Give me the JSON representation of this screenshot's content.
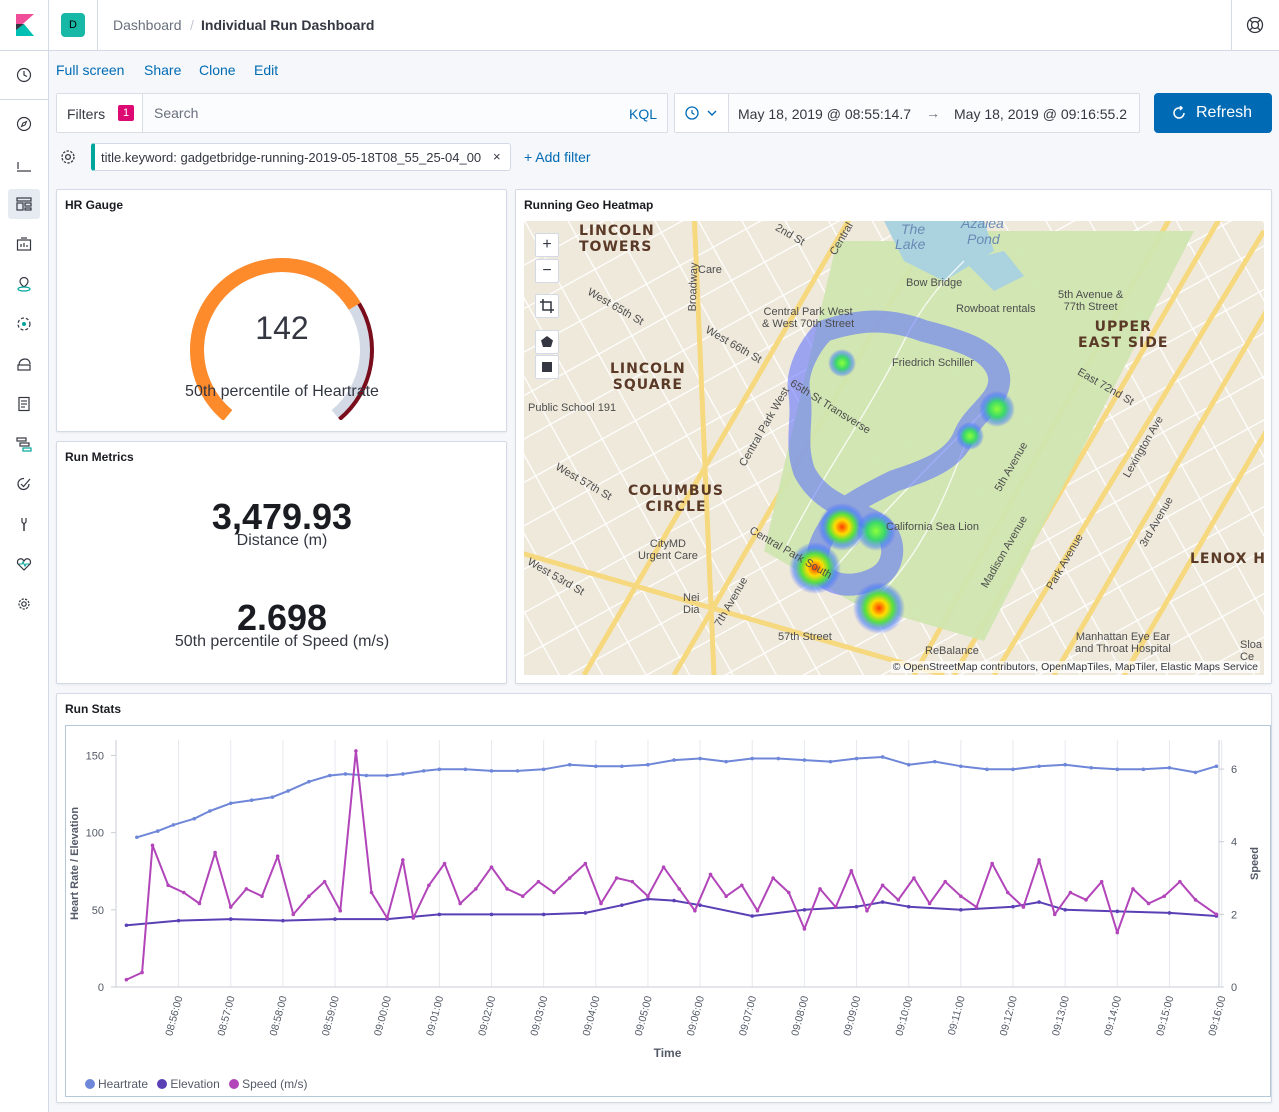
{
  "breadcrumbs": [
    "Dashboard",
    "Individual Run Dashboard"
  ],
  "space_initial": "D",
  "menu": [
    "Full screen",
    "Share",
    "Clone",
    "Edit"
  ],
  "filters": {
    "label": "Filters",
    "count": "1",
    "search_placeholder": "Search",
    "query_language": "KQL"
  },
  "time": {
    "start": "May 18, 2019 @ 08:55:14.7",
    "arrow": "→",
    "end": "May 18, 2019 @ 09:16:55.2"
  },
  "refresh_label": "Refresh",
  "filter_pill": "title.keyword: gadgetbridge-running-2019-05-18T08_55_25-04_00",
  "filter_pill_close": "×",
  "add_filter": "+ Add filter",
  "colors": {
    "accent": "#006bb4",
    "badge": "#dd0a73",
    "filter_pill": "#00a69b",
    "gauge_orange": "#fd8b2c",
    "gauge_dark": "#7a0d1c"
  },
  "panels": {
    "hr_gauge": {
      "title": "HR Gauge",
      "value": "142",
      "label": "50th percentile of Heartrate",
      "value_fraction": 0.71
    },
    "run_metrics": {
      "title": "Run Metrics",
      "metrics": [
        {
          "value": "3,479.93",
          "label": "Distance (m)"
        },
        {
          "value": "2.698",
          "label": "50th percentile of Speed (m/s)"
        }
      ]
    },
    "geo_heatmap": {
      "title": "Running Geo Heatmap",
      "zoom_in": "+",
      "zoom_out": "−",
      "attribution": "© OpenStreetMap contributors, OpenMapTiles, MapTiler, Elastic Maps Service",
      "places_major": [
        "LINCOLN\nTOWERS",
        "LINCOLN\nSQUARE",
        "COLUMBUS\nCIRCLE",
        "UPPER\nEAST SIDE",
        "LENOX HI"
      ],
      "places_minor": [
        "The",
        "Lake",
        "Azalea",
        "Pond",
        "Bow Bridge",
        "Rowboat rentals",
        "5th Avenue &\n77th Street",
        "Central Park West\n& West 70th Street",
        "Friedrich Schiller",
        "Public School 191",
        "California Sea Lion",
        "CityMD\nUrgent Care",
        "57th Street",
        "ReBalance",
        "Manhattan Eye Ear\nand Throat Hospital",
        "Nei\nDia",
        "Sloa\nCe",
        "Care"
      ],
      "streets": [
        "West 65th St",
        "West 66th St",
        "West 57th St",
        "65th St Transverse",
        "Central Park West",
        "Central Park South",
        "East 72nd St",
        "5th Avenue",
        "Madison Avenue",
        "Park Avenue",
        "Lexington Ave",
        "3rd Avenue",
        "Broadway",
        "7th Avenue",
        "Central",
        "2nd St",
        "West 53rd St"
      ]
    },
    "run_stats": {
      "title": "Run Stats",
      "legend": [
        "Heartrate",
        "Elevation",
        "Speed (m/s)"
      ]
    }
  },
  "chart_data": {
    "type": "line",
    "title": "",
    "xlabel": "Time",
    "ylabel": "Heart Rate / Elevation",
    "y2label": "Speed",
    "ylim": [
      0,
      160
    ],
    "y2lim": [
      0,
      6.8
    ],
    "yticks": [
      0,
      50,
      100,
      150
    ],
    "y2ticks": [
      0,
      2,
      4,
      6
    ],
    "x_ticks": [
      "08:56:00",
      "08:57:00",
      "08:58:00",
      "08:59:00",
      "09:00:00",
      "09:01:00",
      "09:02:00",
      "09:03:00",
      "09:04:00",
      "09:05:00",
      "09:06:00",
      "09:07:00",
      "09:08:00",
      "09:09:00",
      "09:10:00",
      "09:11:00",
      "09:12:00",
      "09:13:00",
      "09:14:00",
      "09:15:00",
      "09:16:00"
    ],
    "x_range_minutes": [
      -0.2,
      20.95
    ],
    "grid": true,
    "legend_position": "bottom-left",
    "series": [
      {
        "name": "Heartrate",
        "axis": "left",
        "color": "#6f87d8",
        "x": [
          0.2,
          0.6,
          0.9,
          1.3,
          1.6,
          2.0,
          2.4,
          2.8,
          3.1,
          3.5,
          3.9,
          4.2,
          4.6,
          5.0,
          5.3,
          5.7,
          6.0,
          6.5,
          7.0,
          7.5,
          8.0,
          8.5,
          9.0,
          9.5,
          10.0,
          10.5,
          11.0,
          11.5,
          12.0,
          12.5,
          13.0,
          13.5,
          14.0,
          14.5,
          15.0,
          15.5,
          16.0,
          16.5,
          17.0,
          17.5,
          18.0,
          18.5,
          19.0,
          19.5,
          20.0,
          20.5,
          20.9
        ],
        "values": [
          97,
          101,
          105,
          109,
          114,
          119,
          121,
          123,
          127,
          133,
          137,
          138,
          137,
          137,
          138,
          140,
          141,
          141,
          140,
          140,
          141,
          144,
          143,
          143,
          144,
          147,
          148,
          146,
          148,
          148,
          147,
          146,
          148,
          149,
          144,
          146,
          143,
          141,
          141,
          143,
          144,
          142,
          141,
          141,
          142,
          139,
          143
        ]
      },
      {
        "name": "Elevation",
        "axis": "left",
        "color": "#5a3fb5",
        "x": [
          0.0,
          1.0,
          2.0,
          3.0,
          4.0,
          5.0,
          6.0,
          7.0,
          8.0,
          8.8,
          9.5,
          10.0,
          10.5,
          11.0,
          12.0,
          13.0,
          14.0,
          14.5,
          15.0,
          16.0,
          17.0,
          17.5,
          18.0,
          19.0,
          20.0,
          20.9
        ],
        "values": [
          40,
          43,
          44,
          43,
          44,
          44,
          47,
          47,
          47,
          48,
          53,
          57,
          56,
          53,
          46,
          50,
          52,
          55,
          52,
          50,
          52,
          55,
          50,
          49,
          48,
          46
        ]
      },
      {
        "name": "Speed (m/s)",
        "axis": "right",
        "color": "#b145b9",
        "x": [
          0.0,
          0.3,
          0.5,
          0.8,
          1.1,
          1.4,
          1.7,
          2.0,
          2.3,
          2.6,
          2.9,
          3.2,
          3.5,
          3.8,
          4.1,
          4.4,
          4.7,
          5.0,
          5.3,
          5.5,
          5.8,
          6.1,
          6.4,
          6.7,
          7.0,
          7.3,
          7.6,
          7.9,
          8.2,
          8.5,
          8.8,
          9.1,
          9.4,
          9.7,
          10.0,
          10.3,
          10.6,
          10.9,
          11.2,
          11.5,
          11.8,
          12.1,
          12.4,
          12.7,
          13.0,
          13.3,
          13.6,
          13.9,
          14.2,
          14.5,
          14.8,
          15.1,
          15.4,
          15.7,
          16.0,
          16.3,
          16.6,
          16.9,
          17.2,
          17.5,
          17.8,
          18.1,
          18.4,
          18.7,
          19.0,
          19.3,
          19.6,
          19.9,
          20.2,
          20.5,
          20.9
        ],
        "values": [
          0.2,
          0.4,
          3.9,
          2.8,
          2.6,
          2.3,
          3.7,
          2.2,
          2.7,
          2.5,
          3.6,
          2.0,
          2.5,
          2.9,
          2.1,
          6.5,
          2.6,
          1.9,
          3.5,
          1.9,
          2.8,
          3.4,
          2.3,
          2.7,
          3.3,
          2.7,
          2.5,
          2.9,
          2.6,
          3.0,
          3.4,
          2.3,
          3.0,
          2.9,
          2.5,
          3.3,
          2.7,
          2.1,
          3.1,
          2.5,
          2.8,
          2.1,
          3.0,
          2.6,
          1.6,
          2.7,
          2.2,
          3.2,
          2.1,
          2.8,
          2.4,
          3.0,
          2.3,
          2.9,
          2.5,
          2.2,
          3.4,
          2.6,
          2.2,
          3.5,
          2.0,
          2.6,
          2.4,
          2.9,
          1.5,
          2.7,
          2.3,
          2.5,
          2.9,
          2.4,
          2.0
        ]
      }
    ]
  }
}
